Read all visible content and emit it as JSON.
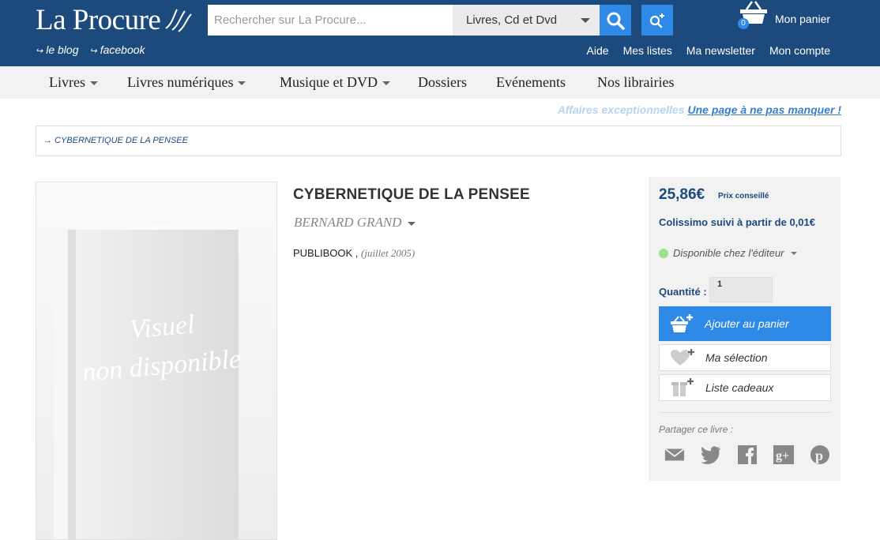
{
  "header": {
    "logo": "La Procure",
    "links_left": [
      "le blog",
      "facebook"
    ],
    "search_placeholder": "Rechercher sur La Procure...",
    "search_category": "Livres, Cd et Dvd",
    "cart_label": "Mon panier",
    "cart_count": "0",
    "links_right": [
      "Aide",
      "Mes listes",
      "Ma newsletter",
      "Mon compte"
    ]
  },
  "nav": {
    "items": [
      {
        "label": "Livres",
        "dropdown": true
      },
      {
        "label": "Livres numériques",
        "dropdown": true
      },
      {
        "label": "Musique et DVD",
        "dropdown": true
      },
      {
        "label": "Dossiers",
        "dropdown": false
      },
      {
        "label": "Evénements",
        "dropdown": false
      },
      {
        "label": "Nos librairies",
        "dropdown": false
      }
    ]
  },
  "promo": {
    "faded": "Affaires exceptionnelles",
    "link": "Une page à ne pas manquer !"
  },
  "breadcrumb": "→ CYBERNETIQUE DE LA PENSEE",
  "book": {
    "image_text_line1": "Visuel",
    "image_text_line2": "non disponible",
    "title": "CYBERNETIQUE DE LA PENSEE",
    "author": "BERNARD GRAND",
    "publisher": "PUBLIBOOK ,",
    "date": "(juillet 2005)"
  },
  "purchase": {
    "price": "25,86€",
    "price_note": "Prix conseillé",
    "shipping": "Colissimo suivi à partir de 0,01€",
    "availability": "Disponible chez l'éditeur",
    "quantity_label": "Quantité :",
    "quantity_value": "1",
    "add_to_cart": "Ajouter au panier",
    "my_selection": "Ma sélection",
    "gift_list": "Liste cadeaux",
    "share_label": "Partager ce livre :"
  },
  "colors": {
    "brand_blue": "#1d4a7c",
    "accent_blue": "#2e8ae6",
    "available_green": "#9be38a"
  }
}
